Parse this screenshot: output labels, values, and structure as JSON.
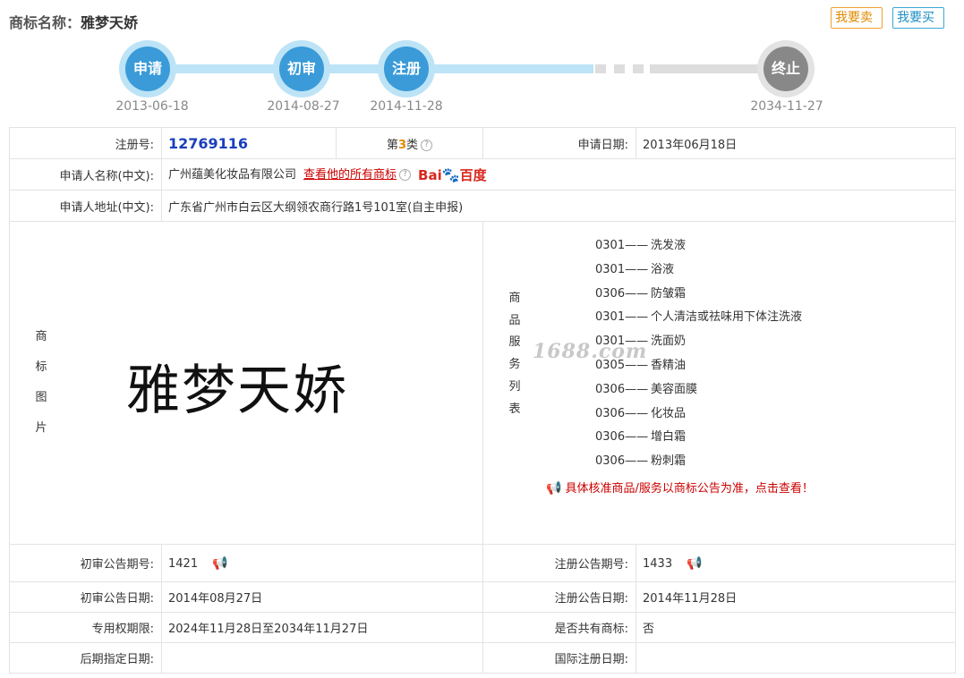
{
  "header": {
    "label": "商标名称：",
    "name": "雅梦天娇",
    "sell_label": "我要卖",
    "buy_label": "我要买"
  },
  "progress": {
    "steps": [
      {
        "label": "申请",
        "date": "2013-06-18"
      },
      {
        "label": "初审",
        "date": "2014-08-27"
      },
      {
        "label": "注册",
        "date": "2014-11-28"
      },
      {
        "label": "终止",
        "date": "2034-11-27"
      }
    ]
  },
  "details": {
    "reg_no_label": "注册号:",
    "reg_no": "12769116",
    "class_prefix": "第",
    "class_num": "3",
    "class_suffix": "类",
    "apply_date_label": "申请日期:",
    "apply_date": "2013年06月18日",
    "applicant_label": "申请人名称(中文):",
    "applicant": "广州蕴美化妆品有限公司",
    "all_marks_link": "查看他的所有商标",
    "baidu_left": "Bai",
    "baidu_right": "百度",
    "address_label": "申请人地址(中文):",
    "address": "广东省广州市白云区大纲领农商行路1号101室(自主申报)",
    "image_label": [
      "商",
      "标",
      "图",
      "片"
    ],
    "mark_text": "雅梦天娇",
    "goods_label": [
      "商",
      "品",
      "服",
      "务",
      "列",
      "表"
    ],
    "watermark": "1688.com",
    "goods": [
      {
        "code": "0301",
        "name": "洗发液"
      },
      {
        "code": "0301",
        "name": "浴液"
      },
      {
        "code": "0306",
        "name": "防皱霜"
      },
      {
        "code": "0301",
        "name": "个人清洁或祛味用下体注洗液"
      },
      {
        "code": "0301",
        "name": "洗面奶"
      },
      {
        "code": "0305",
        "name": "香精油"
      },
      {
        "code": "0306",
        "name": "美容面膜"
      },
      {
        "code": "0306",
        "name": "化妆品"
      },
      {
        "code": "0306",
        "name": "增白霜"
      },
      {
        "code": "0306",
        "name": "粉刺霜"
      }
    ],
    "goods_separator": "——",
    "goods_notice": "具体核准商品/服务以商标公告为准，点击查看！",
    "prelim_no_label": "初审公告期号:",
    "prelim_no": "1421",
    "reg_pub_no_label": "注册公告期号:",
    "reg_pub_no": "1433",
    "prelim_date_label": "初审公告日期:",
    "prelim_date": "2014年08月27日",
    "reg_pub_date_label": "注册公告日期:",
    "reg_pub_date": "2014年11月28日",
    "exclusive_label": "专用权期限:",
    "exclusive": "2024年11月28日至2034年11月27日",
    "shared_label": "是否共有商标:",
    "shared": "否",
    "later_label": "后期指定日期:",
    "later": "",
    "intl_label": "国际注册日期:",
    "intl": ""
  }
}
